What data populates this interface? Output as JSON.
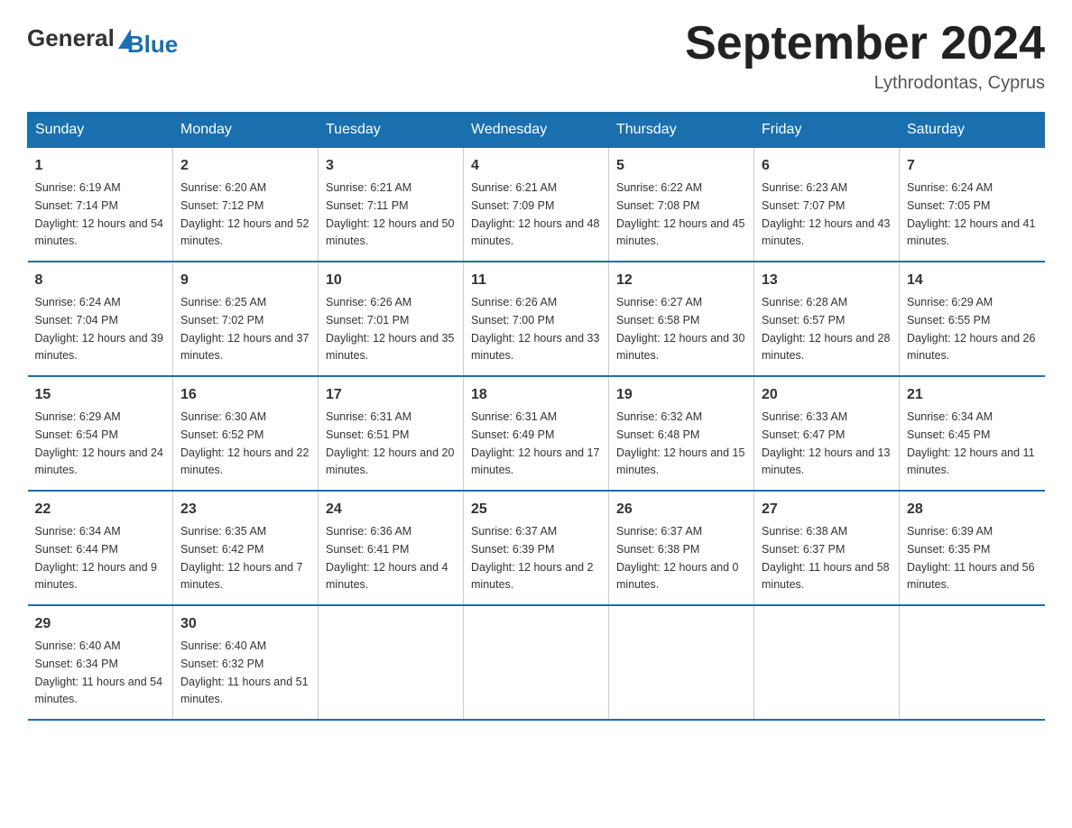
{
  "header": {
    "logo_general": "General",
    "logo_blue": "Blue",
    "title": "September 2024",
    "location": "Lythrodontas, Cyprus"
  },
  "days_of_week": [
    "Sunday",
    "Monday",
    "Tuesday",
    "Wednesday",
    "Thursday",
    "Friday",
    "Saturday"
  ],
  "weeks": [
    [
      {
        "day": "1",
        "sunrise": "Sunrise: 6:19 AM",
        "sunset": "Sunset: 7:14 PM",
        "daylight": "Daylight: 12 hours and 54 minutes."
      },
      {
        "day": "2",
        "sunrise": "Sunrise: 6:20 AM",
        "sunset": "Sunset: 7:12 PM",
        "daylight": "Daylight: 12 hours and 52 minutes."
      },
      {
        "day": "3",
        "sunrise": "Sunrise: 6:21 AM",
        "sunset": "Sunset: 7:11 PM",
        "daylight": "Daylight: 12 hours and 50 minutes."
      },
      {
        "day": "4",
        "sunrise": "Sunrise: 6:21 AM",
        "sunset": "Sunset: 7:09 PM",
        "daylight": "Daylight: 12 hours and 48 minutes."
      },
      {
        "day": "5",
        "sunrise": "Sunrise: 6:22 AM",
        "sunset": "Sunset: 7:08 PM",
        "daylight": "Daylight: 12 hours and 45 minutes."
      },
      {
        "day": "6",
        "sunrise": "Sunrise: 6:23 AM",
        "sunset": "Sunset: 7:07 PM",
        "daylight": "Daylight: 12 hours and 43 minutes."
      },
      {
        "day": "7",
        "sunrise": "Sunrise: 6:24 AM",
        "sunset": "Sunset: 7:05 PM",
        "daylight": "Daylight: 12 hours and 41 minutes."
      }
    ],
    [
      {
        "day": "8",
        "sunrise": "Sunrise: 6:24 AM",
        "sunset": "Sunset: 7:04 PM",
        "daylight": "Daylight: 12 hours and 39 minutes."
      },
      {
        "day": "9",
        "sunrise": "Sunrise: 6:25 AM",
        "sunset": "Sunset: 7:02 PM",
        "daylight": "Daylight: 12 hours and 37 minutes."
      },
      {
        "day": "10",
        "sunrise": "Sunrise: 6:26 AM",
        "sunset": "Sunset: 7:01 PM",
        "daylight": "Daylight: 12 hours and 35 minutes."
      },
      {
        "day": "11",
        "sunrise": "Sunrise: 6:26 AM",
        "sunset": "Sunset: 7:00 PM",
        "daylight": "Daylight: 12 hours and 33 minutes."
      },
      {
        "day": "12",
        "sunrise": "Sunrise: 6:27 AM",
        "sunset": "Sunset: 6:58 PM",
        "daylight": "Daylight: 12 hours and 30 minutes."
      },
      {
        "day": "13",
        "sunrise": "Sunrise: 6:28 AM",
        "sunset": "Sunset: 6:57 PM",
        "daylight": "Daylight: 12 hours and 28 minutes."
      },
      {
        "day": "14",
        "sunrise": "Sunrise: 6:29 AM",
        "sunset": "Sunset: 6:55 PM",
        "daylight": "Daylight: 12 hours and 26 minutes."
      }
    ],
    [
      {
        "day": "15",
        "sunrise": "Sunrise: 6:29 AM",
        "sunset": "Sunset: 6:54 PM",
        "daylight": "Daylight: 12 hours and 24 minutes."
      },
      {
        "day": "16",
        "sunrise": "Sunrise: 6:30 AM",
        "sunset": "Sunset: 6:52 PM",
        "daylight": "Daylight: 12 hours and 22 minutes."
      },
      {
        "day": "17",
        "sunrise": "Sunrise: 6:31 AM",
        "sunset": "Sunset: 6:51 PM",
        "daylight": "Daylight: 12 hours and 20 minutes."
      },
      {
        "day": "18",
        "sunrise": "Sunrise: 6:31 AM",
        "sunset": "Sunset: 6:49 PM",
        "daylight": "Daylight: 12 hours and 17 minutes."
      },
      {
        "day": "19",
        "sunrise": "Sunrise: 6:32 AM",
        "sunset": "Sunset: 6:48 PM",
        "daylight": "Daylight: 12 hours and 15 minutes."
      },
      {
        "day": "20",
        "sunrise": "Sunrise: 6:33 AM",
        "sunset": "Sunset: 6:47 PM",
        "daylight": "Daylight: 12 hours and 13 minutes."
      },
      {
        "day": "21",
        "sunrise": "Sunrise: 6:34 AM",
        "sunset": "Sunset: 6:45 PM",
        "daylight": "Daylight: 12 hours and 11 minutes."
      }
    ],
    [
      {
        "day": "22",
        "sunrise": "Sunrise: 6:34 AM",
        "sunset": "Sunset: 6:44 PM",
        "daylight": "Daylight: 12 hours and 9 minutes."
      },
      {
        "day": "23",
        "sunrise": "Sunrise: 6:35 AM",
        "sunset": "Sunset: 6:42 PM",
        "daylight": "Daylight: 12 hours and 7 minutes."
      },
      {
        "day": "24",
        "sunrise": "Sunrise: 6:36 AM",
        "sunset": "Sunset: 6:41 PM",
        "daylight": "Daylight: 12 hours and 4 minutes."
      },
      {
        "day": "25",
        "sunrise": "Sunrise: 6:37 AM",
        "sunset": "Sunset: 6:39 PM",
        "daylight": "Daylight: 12 hours and 2 minutes."
      },
      {
        "day": "26",
        "sunrise": "Sunrise: 6:37 AM",
        "sunset": "Sunset: 6:38 PM",
        "daylight": "Daylight: 12 hours and 0 minutes."
      },
      {
        "day": "27",
        "sunrise": "Sunrise: 6:38 AM",
        "sunset": "Sunset: 6:37 PM",
        "daylight": "Daylight: 11 hours and 58 minutes."
      },
      {
        "day": "28",
        "sunrise": "Sunrise: 6:39 AM",
        "sunset": "Sunset: 6:35 PM",
        "daylight": "Daylight: 11 hours and 56 minutes."
      }
    ],
    [
      {
        "day": "29",
        "sunrise": "Sunrise: 6:40 AM",
        "sunset": "Sunset: 6:34 PM",
        "daylight": "Daylight: 11 hours and 54 minutes."
      },
      {
        "day": "30",
        "sunrise": "Sunrise: 6:40 AM",
        "sunset": "Sunset: 6:32 PM",
        "daylight": "Daylight: 11 hours and 51 minutes."
      },
      {
        "day": "",
        "sunrise": "",
        "sunset": "",
        "daylight": ""
      },
      {
        "day": "",
        "sunrise": "",
        "sunset": "",
        "daylight": ""
      },
      {
        "day": "",
        "sunrise": "",
        "sunset": "",
        "daylight": ""
      },
      {
        "day": "",
        "sunrise": "",
        "sunset": "",
        "daylight": ""
      },
      {
        "day": "",
        "sunrise": "",
        "sunset": "",
        "daylight": ""
      }
    ]
  ]
}
